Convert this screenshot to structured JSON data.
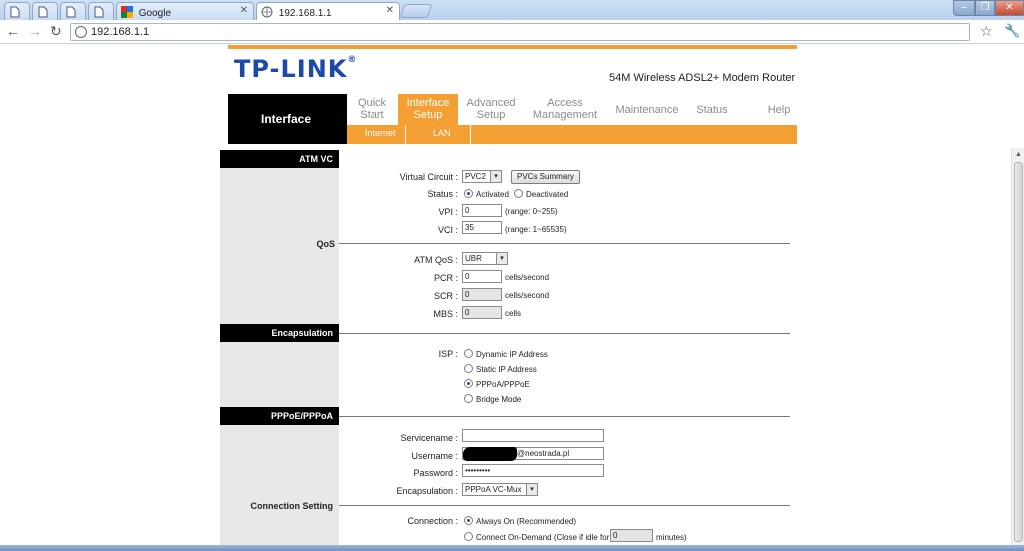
{
  "browser": {
    "tabs": [
      {
        "label": "",
        "icon": "document-icon"
      },
      {
        "label": "",
        "icon": "document-icon"
      },
      {
        "label": "",
        "icon": "document-icon"
      },
      {
        "label": "",
        "icon": "document-icon"
      },
      {
        "label": "Google",
        "icon": "google-icon"
      },
      {
        "label": "192.168.1.1",
        "icon": "globe-icon"
      }
    ],
    "url": "192.168.1.1"
  },
  "header": {
    "logo": "TP-LINK",
    "logo_mark": "®",
    "model": "54M Wireless ADSL2+ Modem Router",
    "section": "Interface"
  },
  "menu": [
    {
      "line1": "Quick",
      "line2": "Start"
    },
    {
      "line1": "Interface",
      "line2": "Setup"
    },
    {
      "line1": "Advanced",
      "line2": "Setup"
    },
    {
      "line1": "Access",
      "line2": "Management"
    },
    {
      "line1": "Maintenance",
      "line2": ""
    },
    {
      "line1": "Status",
      "line2": ""
    },
    {
      "line1": "Help",
      "line2": ""
    }
  ],
  "submenu": [
    "Internet",
    "LAN"
  ],
  "sections": {
    "atm_vc": "ATM VC",
    "qos": "QoS",
    "encapsulation": "Encapsulation",
    "pppoe": "PPPoE/PPPoA",
    "connection": "Connection Setting"
  },
  "atm": {
    "virtual_circuit_label": "Virtual Circuit :",
    "virtual_circuit_value": "PVC2",
    "pvcs_summary": "PVCs Summary",
    "status_label": "Status :",
    "status_activated": "Activated",
    "status_deactivated": "Deactivated",
    "vpi_label": "VPI :",
    "vpi_value": "0",
    "vpi_range": "(range: 0~255)",
    "vci_label": "VCI :",
    "vci_value": "35",
    "vci_range": "(range: 1~65535)"
  },
  "qos": {
    "atm_qos_label": "ATM QoS :",
    "atm_qos_value": "UBR",
    "pcr_label": "PCR :",
    "pcr_value": "0",
    "pcr_unit": "cells/second",
    "scr_label": "SCR :",
    "scr_value": "0",
    "scr_unit": "cells/second",
    "mbs_label": "MBS :",
    "mbs_value": "0",
    "mbs_unit": "cells"
  },
  "isp": {
    "label": "ISP :",
    "options": [
      "Dynamic IP Address",
      "Static IP Address",
      "PPPoA/PPPoE",
      "Bridge Mode"
    ]
  },
  "pppoe": {
    "servicename_label": "Servicename :",
    "servicename_value": "",
    "username_label": "Username :",
    "username_value": "@neostrada.pl",
    "password_label": "Password :",
    "password_value": "•••••••••",
    "encap_label": "Encapsulation :",
    "encap_value": "PPPoA VC-Mux"
  },
  "connection": {
    "label": "Connection :",
    "always_on": "Always On (Recommended)",
    "on_demand": "Connect On-Demand (Close if idle for",
    "idle_value": "0",
    "idle_unit": "minutes)"
  }
}
